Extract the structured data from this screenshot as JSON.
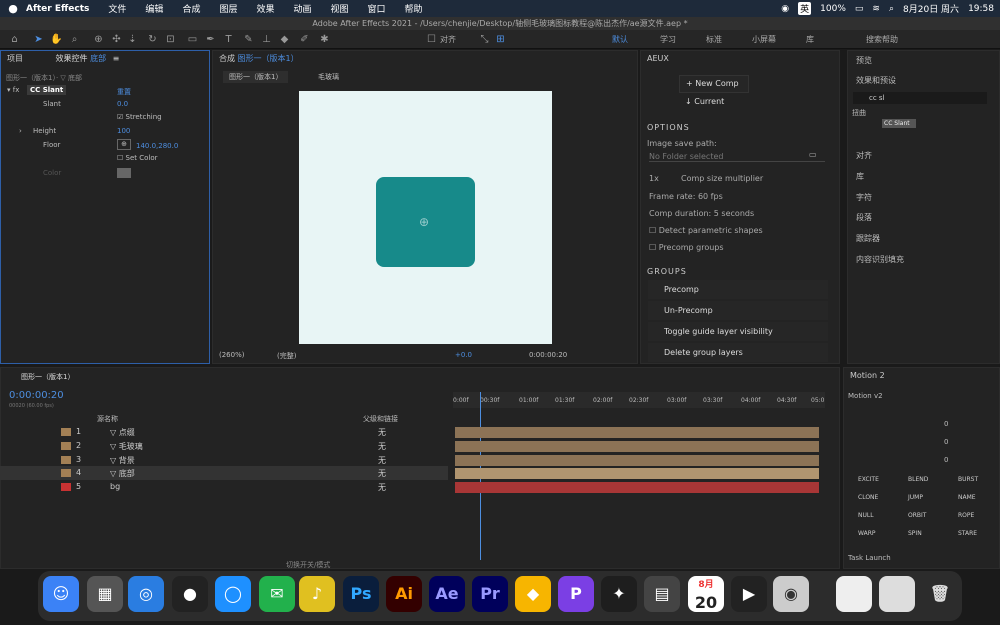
{
  "menubar": {
    "app": "After Effects",
    "items": [
      "文件",
      "编辑",
      "合成",
      "图层",
      "效果",
      "动画",
      "视图",
      "窗口",
      "帮助"
    ],
    "battery": "100%",
    "ime": "英",
    "date": "8月20日 周六",
    "time": "19:58"
  },
  "titlebar": {
    "title": "Adobe After Effects 2021 - /Users/chenjie/Desktop/轴侧毛玻璃图标教程@陈出杰作/ae源文件.aep *"
  },
  "toolbar": {
    "snap_label": "对齐",
    "workspaces": [
      "默认",
      "学习",
      "标准",
      "小屏幕",
      "库"
    ],
    "search_placeholder": "搜索帮助"
  },
  "effects_panel": {
    "tab_project": "项目",
    "tab_effects": "效果控件",
    "tab_layer": "底部",
    "breadcrumb": "图形一（版本1）· ▽ 底部",
    "effect_name": "CC Slant",
    "reset": "重置",
    "props": [
      {
        "name": "Slant",
        "value": "0.0"
      },
      {
        "name": "",
        "value": "Stretching"
      },
      {
        "name": "Height",
        "value": "100"
      },
      {
        "name": "Floor",
        "value": "140.0,280.0"
      },
      {
        "name": "",
        "value": "Set Color"
      },
      {
        "name": "Color",
        "value": ""
      }
    ]
  },
  "comp_panel": {
    "title": "合成",
    "comp_name": "图形一（版本1）",
    "tab": "图形一（版本1）",
    "layer": "毛玻璃",
    "zoom": "(260%)",
    "quality": "(完整)",
    "exposure": "+0.0",
    "timecode": "0:00:00:20"
  },
  "aeux": {
    "title": "AEUX",
    "new_comp": "New Comp",
    "current": "Current",
    "options": "OPTIONS",
    "save_path_label": "Image save path:",
    "save_path_value": "No Folder selected",
    "multiplier": "1x",
    "multiplier_label": "Comp size multiplier",
    "frame_rate": "Frame rate:  60  fps",
    "duration": "Comp duration:  5  seconds",
    "detect": "Detect parametric shapes",
    "precomp_groups": "Precomp groups",
    "groups": "GROUPS",
    "group_buttons": [
      "Precomp",
      "Un-Precomp",
      "Toggle guide layer visibility",
      "Delete group layers"
    ]
  },
  "right_panel": {
    "preview": "预览",
    "effects_presets": "效果和预设",
    "search_value": "cc sl",
    "category": "扭曲",
    "result": "CC Slant",
    "items": [
      "对齐",
      "库",
      "字符",
      "段落",
      "跟踪器",
      "内容识别填充"
    ]
  },
  "timeline": {
    "comp_tab": "图形一（版本1）",
    "timecode": "0:00:00:20",
    "fps": "00020 (60.00 fps)",
    "col_name": "源名称",
    "col_parent": "父级和链接",
    "ruler": [
      "0:00f",
      "00:30f",
      "01:00f",
      "01:30f",
      "02:00f",
      "02:30f",
      "03:00f",
      "03:30f",
      "04:00f",
      "04:30f",
      "05:0"
    ],
    "layers": [
      {
        "num": "1",
        "name": "▽ 点缀",
        "parent": "无",
        "color": "#a38055"
      },
      {
        "num": "2",
        "name": "▽ 毛玻璃",
        "parent": "无",
        "color": "#a38055"
      },
      {
        "num": "3",
        "name": "▽ 背景",
        "parent": "无",
        "color": "#a38055"
      },
      {
        "num": "4",
        "name": "▽ 底部",
        "parent": "无",
        "color": "#a38055"
      },
      {
        "num": "5",
        "name": "bg",
        "parent": "无",
        "color": "#c83232"
      }
    ],
    "footer": "切换开关/模式"
  },
  "motion": {
    "title": "Motion 2",
    "preset": "Motion v2",
    "sliders": [
      "0",
      "0",
      "0"
    ],
    "buttons": [
      "EXCITE",
      "BLEND",
      "BURST",
      "CLONE",
      "JUMP",
      "NAME",
      "NULL",
      "ORBIT",
      "ROPE",
      "WARP",
      "SPIN",
      "STARE"
    ],
    "task": "Task Launch"
  },
  "dock": {
    "date_month": "8月",
    "date_day": "20",
    "apps": [
      "Ps",
      "Ai",
      "Ae",
      "Pr"
    ]
  },
  "colors": {
    "accent": "#2e6be6",
    "teal": "#178a8a",
    "canvas": "#e8f5f5"
  }
}
